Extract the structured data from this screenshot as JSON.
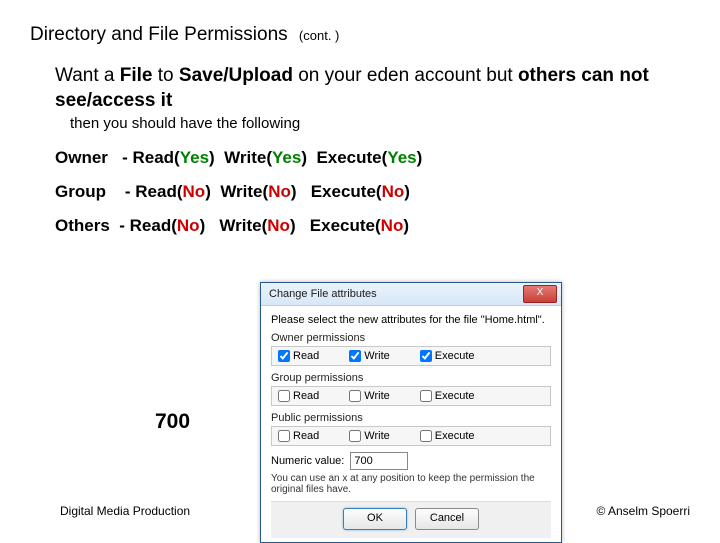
{
  "title": "Directory and File Permissions",
  "title_cont": "(cont. )",
  "main_text_prefix": "Want a ",
  "main_text_bold1": "File",
  "main_text_mid": " to ",
  "main_text_bold2": "Save/Upload",
  "main_text_after": " on your eden account but ",
  "main_text_bold3": "others can not see/access it",
  "sub_text": "then you should have the following",
  "perm_owner_label": "Owner",
  "perm_group_label": "Group",
  "perm_others_label": "Others",
  "read_label": "Read",
  "write_label": "Write",
  "execute_label": "Execute",
  "yes": "Yes",
  "no": "No",
  "dash": " - ",
  "number700": "700",
  "footer_left": "Digital Media Production",
  "footer_right": "© Anselm Spoerri",
  "dialog": {
    "title": "Change File attributes",
    "close": "X",
    "instruction": "Please select the new attributes for the file \"Home.html\".",
    "owner_group": "Owner permissions",
    "group_group": "Group permissions",
    "public_group": "Public permissions",
    "read": "Read",
    "write": "Write",
    "execute": "Execute",
    "numeric_label": "Numeric value:",
    "numeric_value": "700",
    "hint": "You can use an x at any position to keep the permission the original files have.",
    "ok": "OK",
    "cancel": "Cancel"
  }
}
